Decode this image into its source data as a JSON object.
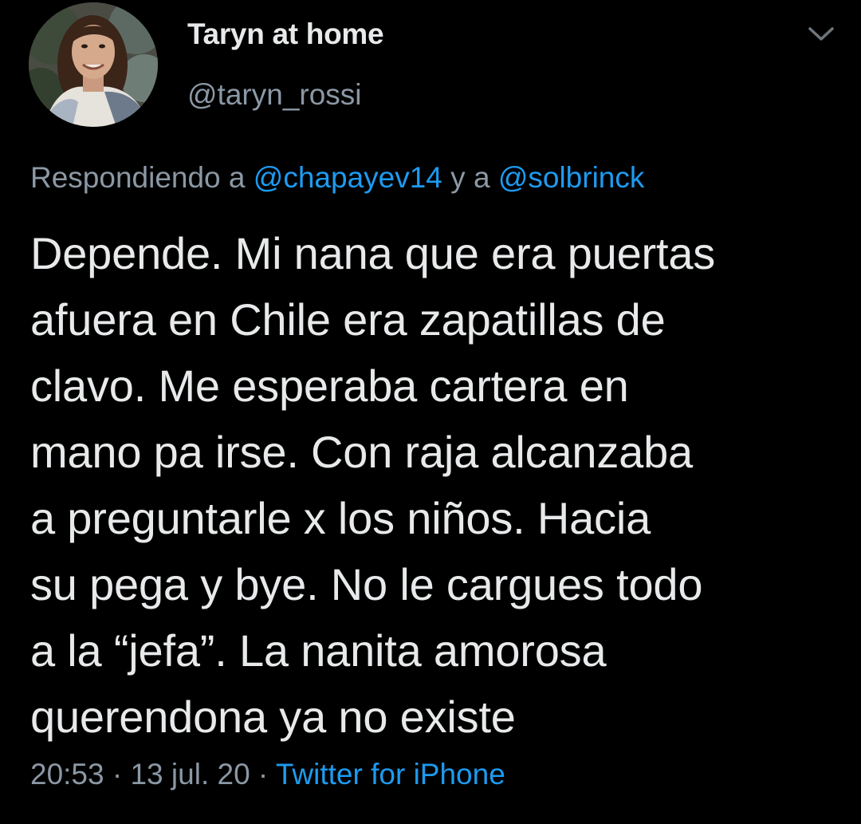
{
  "author": {
    "display_name": "Taryn at home",
    "handle": "@taryn_rossi",
    "avatar_icon": "profile-photo"
  },
  "menu": {
    "icon": "chevron-down-icon"
  },
  "reply": {
    "prefix": "Respondiendo a ",
    "mention_1": "@chapayev14",
    "joiner": " y a ",
    "mention_2": "@solbrinck"
  },
  "tweet": {
    "text": "Depende. Mi nana que era puertas\nafuera en Chile era zapatillas de\nclavo. Me esperaba cartera en\nmano pa irse. Con raja alcanzaba\na preguntarle x los niños. Hacia\nsu pega y bye. No le cargues todo\na la “jefa”. La nanita amorosa\nquerendona ya no existe"
  },
  "meta": {
    "time": "20:53",
    "sep_1": " · ",
    "date": "13 jul. 20",
    "sep_2": " · ",
    "source": "Twitter for iPhone"
  },
  "colors": {
    "background": "#000000",
    "text": "#e7e9ea",
    "secondary": "#8b98a5",
    "link": "#1d9bf0"
  }
}
